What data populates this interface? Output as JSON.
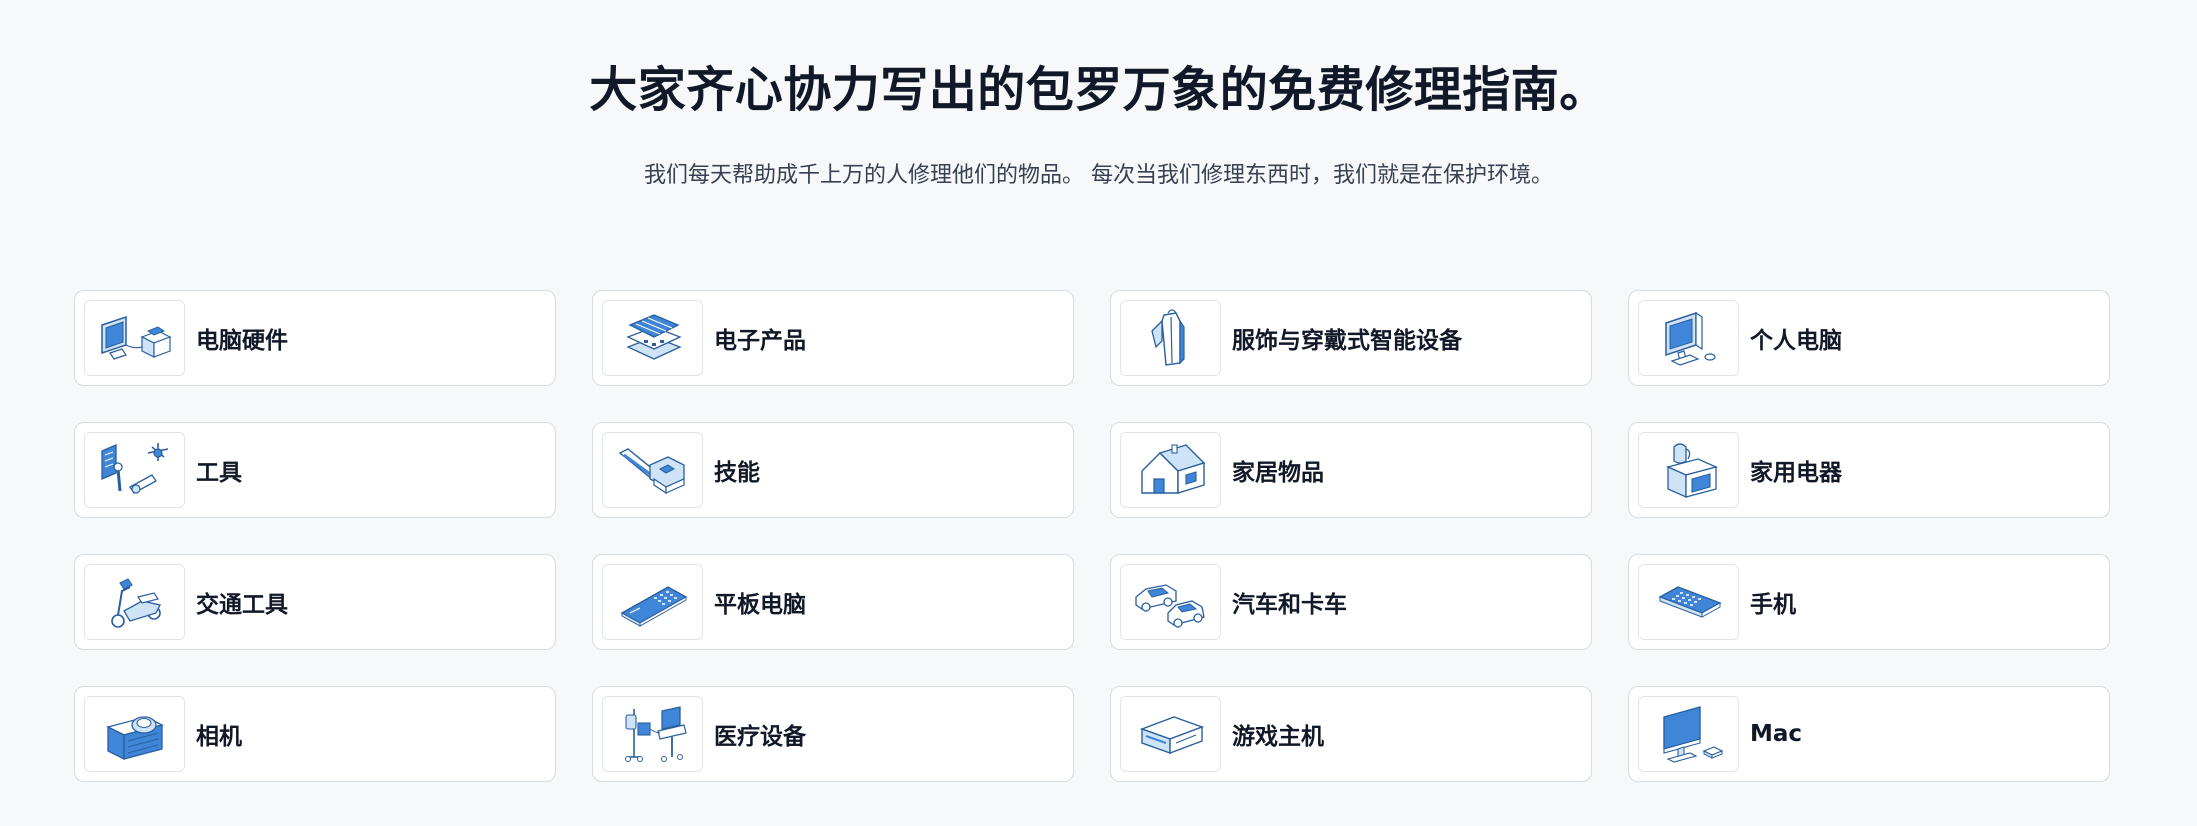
{
  "header": {
    "title": "大家齐心协力写出的包罗万象的免费修理指南。",
    "subtitle": "我们每天帮助成千上万的人修理他们的物品。 每次当我们修理东西时，我们就是在保护环境。"
  },
  "colors": {
    "icon_blue": "#3f86d8",
    "icon_light": "#cfe3f7",
    "icon_stroke": "#2a5f9e"
  },
  "categories": [
    {
      "label": "电脑硬件",
      "icon": "computer-hardware-icon"
    },
    {
      "label": "电子产品",
      "icon": "circuit-board-icon"
    },
    {
      "label": "服饰与穿戴式智能设备",
      "icon": "jacket-icon"
    },
    {
      "label": "个人电脑",
      "icon": "desktop-pc-icon"
    },
    {
      "label": "工具",
      "icon": "tools-icon"
    },
    {
      "label": "技能",
      "icon": "soldering-skill-icon"
    },
    {
      "label": "家居物品",
      "icon": "house-icon"
    },
    {
      "label": "家用电器",
      "icon": "appliance-icon"
    },
    {
      "label": "交通工具",
      "icon": "scooter-icon"
    },
    {
      "label": "平板电脑",
      "icon": "tablet-icon"
    },
    {
      "label": "汽车和卡车",
      "icon": "car-truck-icon"
    },
    {
      "label": "手机",
      "icon": "phone-icon"
    },
    {
      "label": "相机",
      "icon": "camera-icon"
    },
    {
      "label": "医疗设备",
      "icon": "medical-device-icon"
    },
    {
      "label": "游戏主机",
      "icon": "game-console-icon"
    },
    {
      "label": "Mac",
      "icon": "mac-icon"
    }
  ]
}
